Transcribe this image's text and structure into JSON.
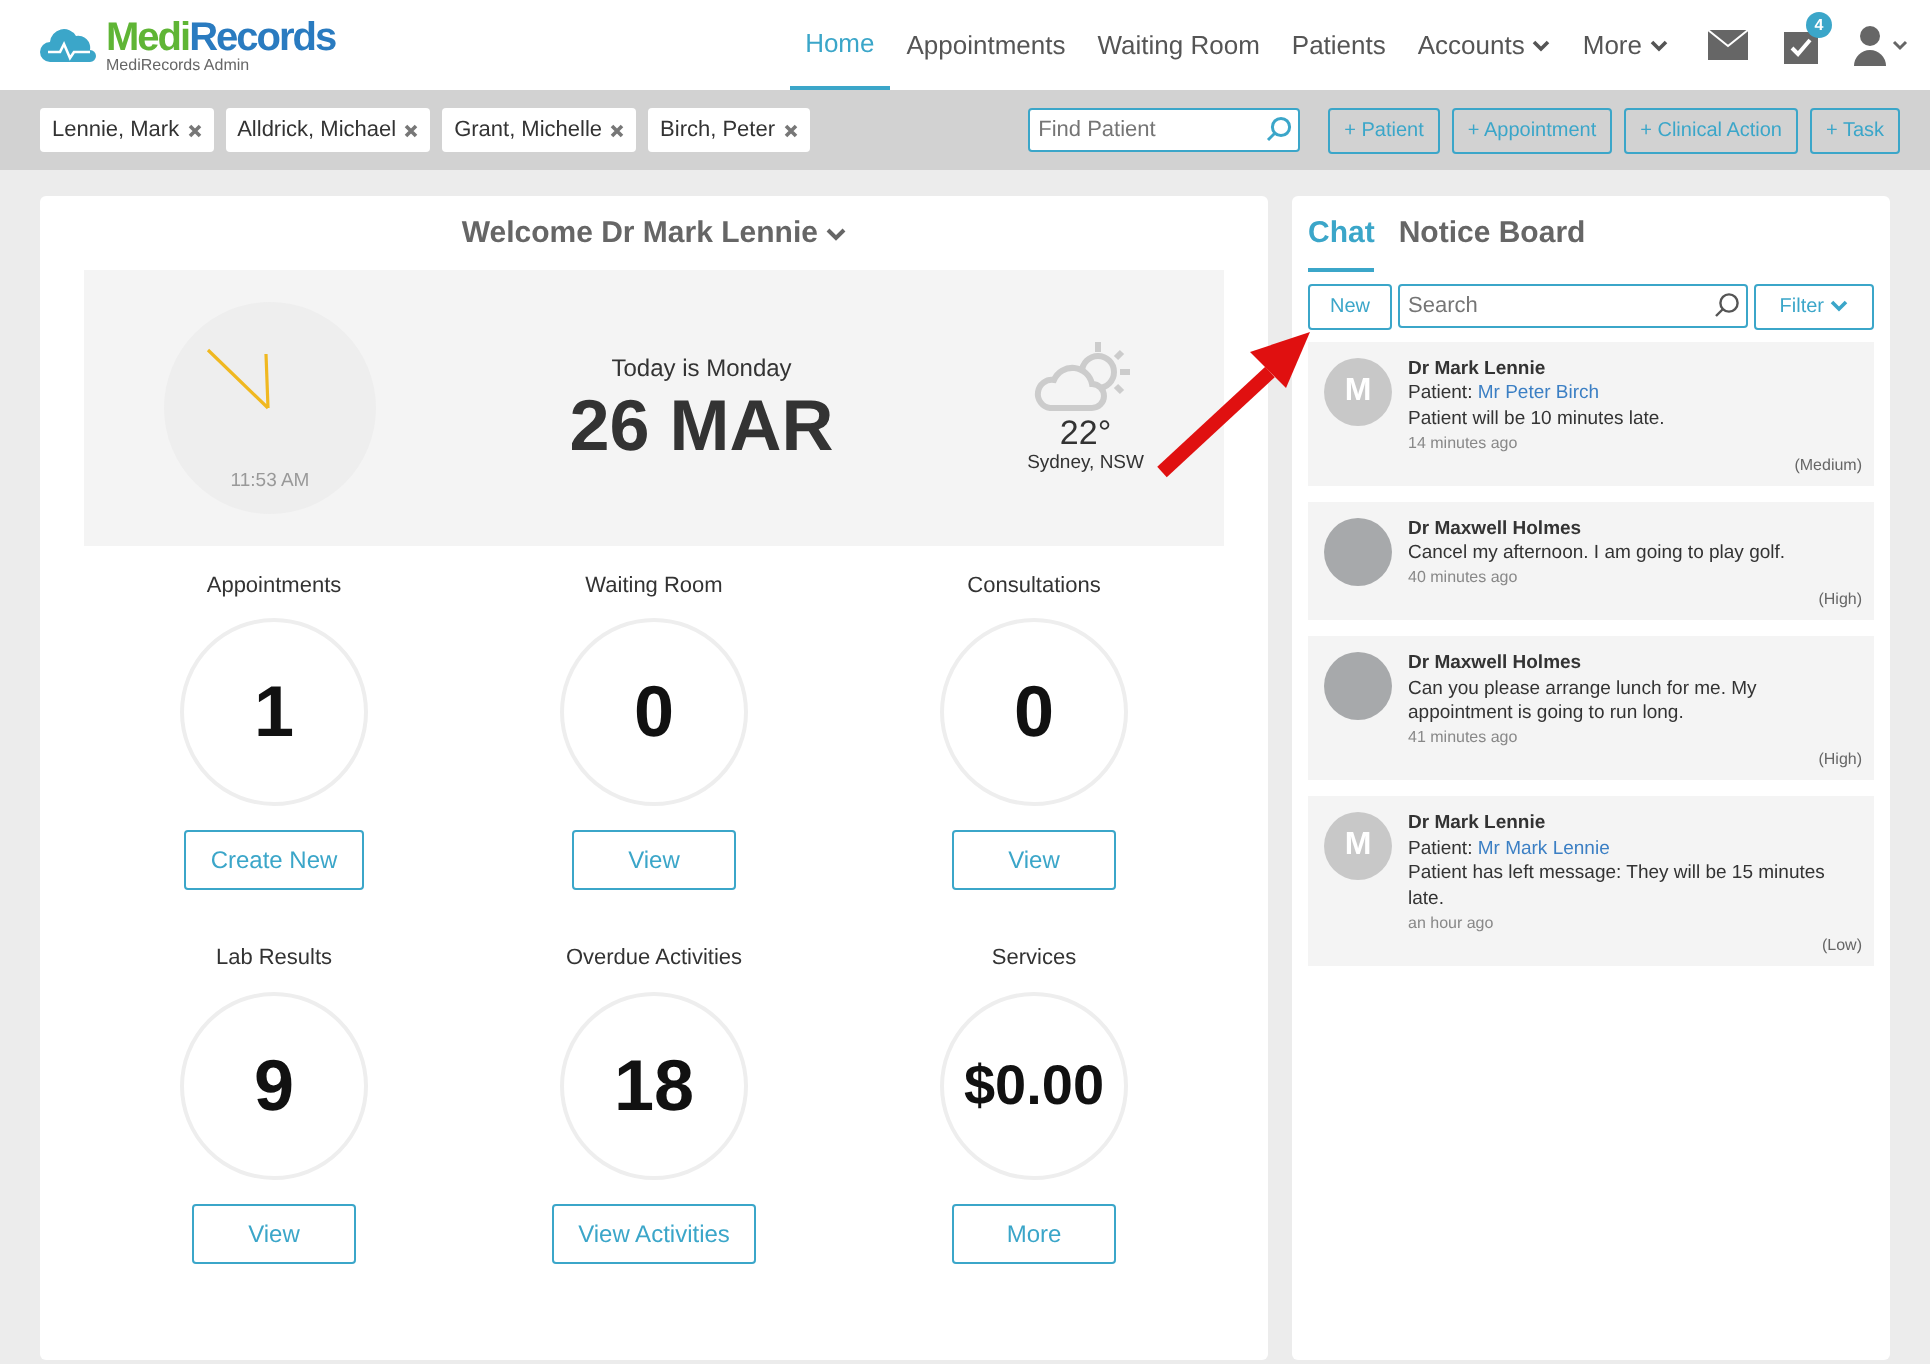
{
  "brand": {
    "name": "MediRecords",
    "subtitle": "MediRecords Admin"
  },
  "nav": [
    {
      "label": "Home",
      "selected": true,
      "has_menu": false
    },
    {
      "label": "Appointments",
      "selected": false,
      "has_menu": false
    },
    {
      "label": "Waiting Room",
      "selected": false,
      "has_menu": false
    },
    {
      "label": "Patients",
      "selected": false,
      "has_menu": false
    },
    {
      "label": "Accounts",
      "selected": false,
      "has_menu": true
    },
    {
      "label": "More",
      "selected": false,
      "has_menu": true
    }
  ],
  "tasks_badge": "4",
  "patient_tabs": [
    "Lennie, Mark",
    "Alldrick, Michael",
    "Grant, Michelle",
    "Birch, Peter"
  ],
  "find_patient": {
    "placeholder": "Find Patient"
  },
  "actions": [
    "+ Patient",
    "+ Appointment",
    "+ Clinical Action",
    "+ Task"
  ],
  "welcome": "Welcome Dr Mark Lennie",
  "clock": {
    "time": "11:53 AM"
  },
  "today": {
    "label": "Today is Monday",
    "date": "26 MAR"
  },
  "weather": {
    "temperature": "22°",
    "location": "Sydney, NSW"
  },
  "stats": [
    {
      "label": "Appointments",
      "value": "1",
      "button": "Create New"
    },
    {
      "label": "Waiting Room",
      "value": "0",
      "button": "View"
    },
    {
      "label": "Consultations",
      "value": "0",
      "button": "View"
    },
    {
      "label": "Lab Results",
      "value": "9",
      "button": "View"
    },
    {
      "label": "Overdue Activities",
      "value": "18",
      "button": "View Activities"
    },
    {
      "label": "Services",
      "value": "$0.00",
      "button": "More"
    }
  ],
  "side_tabs": [
    {
      "label": "Chat",
      "selected": true
    },
    {
      "label": "Notice Board",
      "selected": false
    }
  ],
  "chat_toolbar": {
    "new_button": "New",
    "search_placeholder": "Search",
    "filter": "Filter"
  },
  "messages": [
    {
      "kind": "letter",
      "initial": "M",
      "author": "Dr Mark Lennie",
      "patient_label": "Patient:",
      "patient": "Mr Peter Birch",
      "text": "Patient will be 10 minutes late.",
      "time": "14 minutes ago",
      "priority": "(Medium)"
    },
    {
      "kind": "photo",
      "author": "Dr Maxwell Holmes",
      "text": "Cancel my afternoon. I am going to play golf.",
      "time": "40 minutes ago",
      "priority": "(High)"
    },
    {
      "kind": "photo",
      "author": "Dr Maxwell Holmes",
      "text": "Can you please arrange lunch for me. My appointment is going to run long.",
      "time": "41 minutes ago",
      "priority": "(High)"
    },
    {
      "kind": "letter",
      "initial": "M",
      "author": "Dr Mark Lennie",
      "patient_label": "Patient:",
      "patient": "Mr Mark Lennie",
      "text": "Patient has left message: They will be 15 minutes late.",
      "time": "an hour ago",
      "priority": "(Low)"
    }
  ]
}
